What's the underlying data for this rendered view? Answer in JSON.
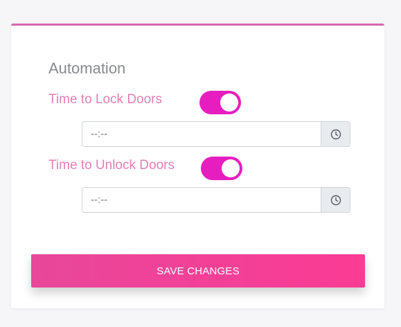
{
  "automation": {
    "title": "Automation",
    "lock": {
      "label": "Time to Lock Doors",
      "enabled": true,
      "time_value": "",
      "time_placeholder": "--:--"
    },
    "unlock": {
      "label": "Time to Unlock Doors",
      "enabled": true,
      "time_value": "",
      "time_placeholder": "--:--"
    },
    "save_label": "SAVE CHANGES"
  },
  "icons": {
    "clock": "clock-icon"
  },
  "colors": {
    "accent_border": "#d966b0",
    "label_pink": "#e17fb5",
    "toggle_on": "#e61ec0",
    "button_start": "#e8479a",
    "button_end": "#fb3b94"
  }
}
